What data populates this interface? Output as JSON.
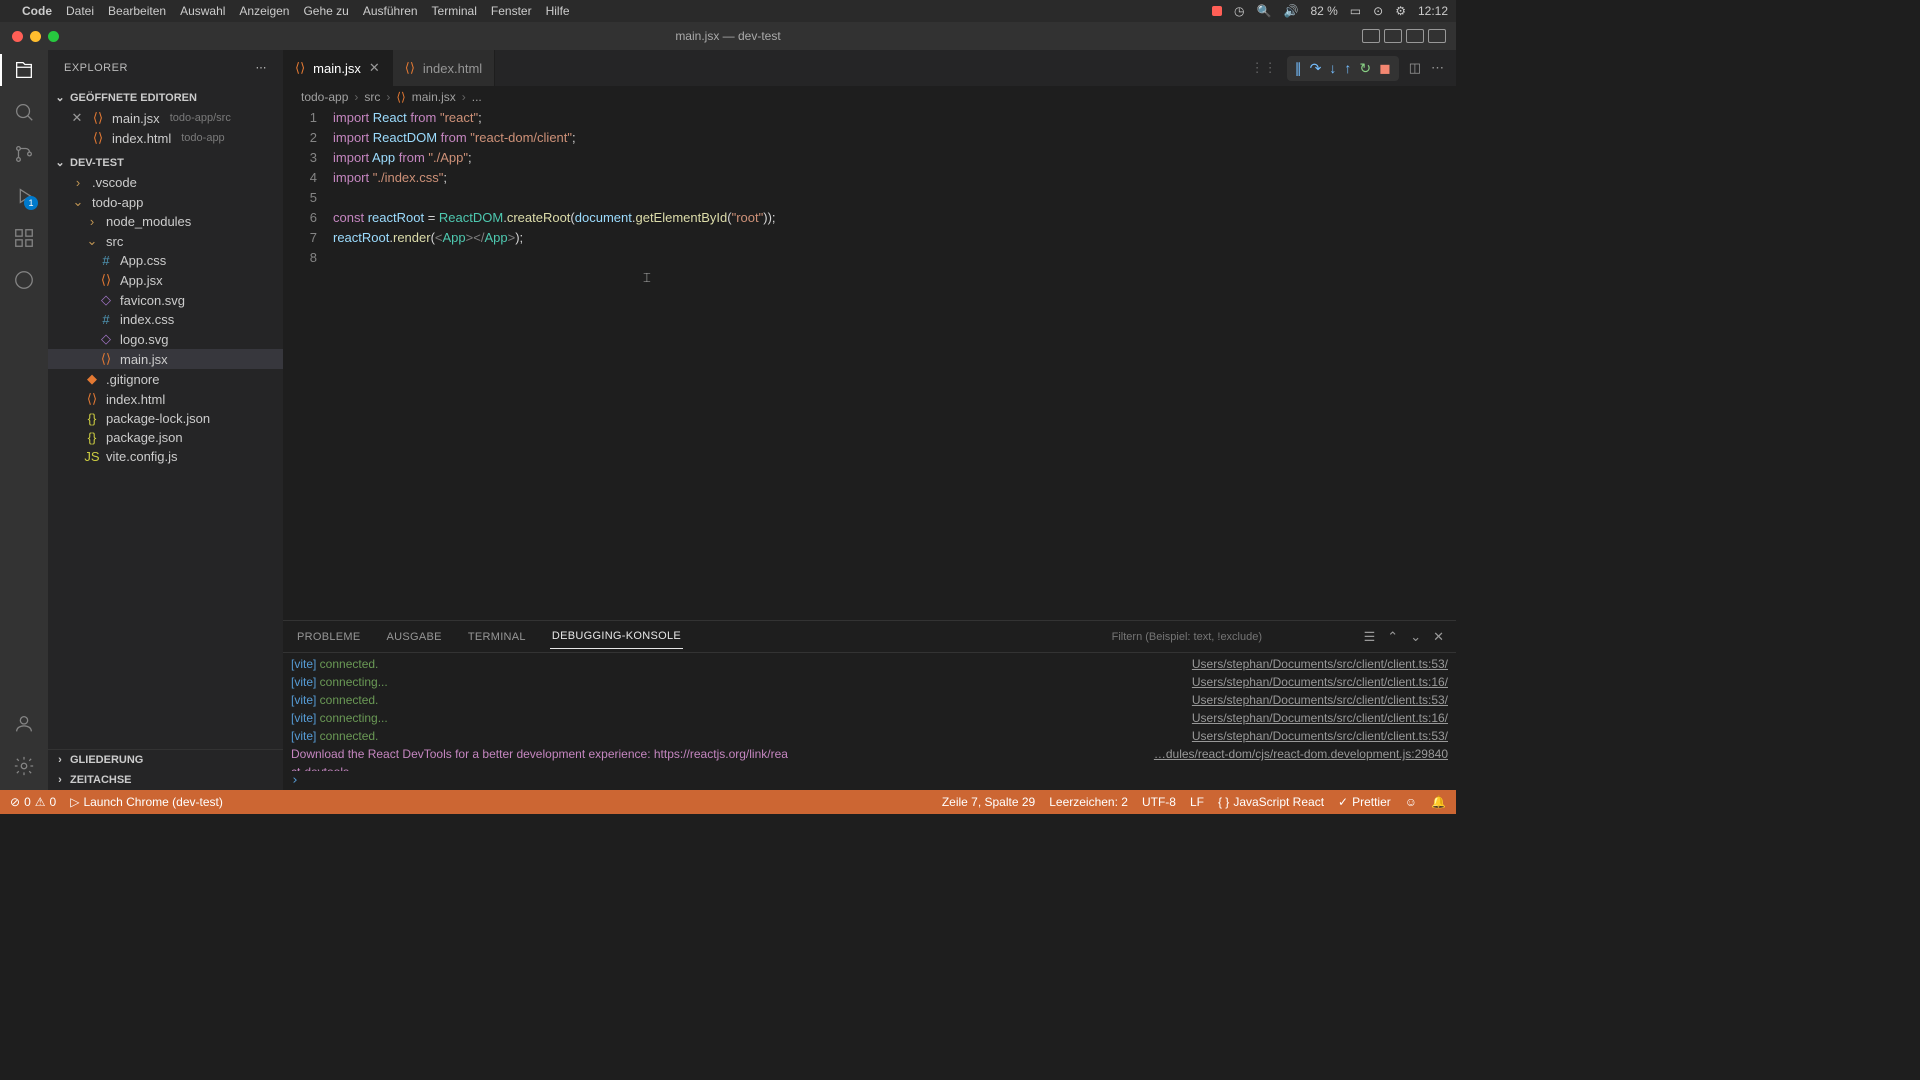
{
  "menubar": {
    "app": "Code",
    "items": [
      "Datei",
      "Bearbeiten",
      "Auswahl",
      "Anzeigen",
      "Gehe zu",
      "Ausführen",
      "Terminal",
      "Fenster",
      "Hilfe"
    ],
    "battery": "82 %",
    "time": "12:12"
  },
  "window": {
    "title": "main.jsx — dev-test"
  },
  "sidebar": {
    "title": "EXPLORER",
    "openEditors": {
      "label": "GEÖFFNETE EDITOREN",
      "items": [
        {
          "name": "main.jsx",
          "hint": "todo-app/src",
          "icon": "jsx",
          "close": true
        },
        {
          "name": "index.html",
          "hint": "todo-app",
          "icon": "html",
          "close": false
        }
      ]
    },
    "project": {
      "label": "DEV-TEST",
      "tree": [
        {
          "name": ".vscode",
          "type": "folder",
          "level": 1
        },
        {
          "name": "todo-app",
          "type": "folder",
          "level": 1,
          "open": true
        },
        {
          "name": "node_modules",
          "type": "folder",
          "level": 2
        },
        {
          "name": "src",
          "type": "folder",
          "level": 2,
          "open": true
        },
        {
          "name": "App.css",
          "type": "css",
          "level": 3
        },
        {
          "name": "App.jsx",
          "type": "jsx",
          "level": 3
        },
        {
          "name": "favicon.svg",
          "type": "svg",
          "level": 3
        },
        {
          "name": "index.css",
          "type": "css",
          "level": 3
        },
        {
          "name": "logo.svg",
          "type": "svg",
          "level": 3
        },
        {
          "name": "main.jsx",
          "type": "jsx",
          "level": 3,
          "selected": true
        },
        {
          "name": ".gitignore",
          "type": "git",
          "level": 2
        },
        {
          "name": "index.html",
          "type": "html",
          "level": 2
        },
        {
          "name": "package-lock.json",
          "type": "json",
          "level": 2
        },
        {
          "name": "package.json",
          "type": "json",
          "level": 2
        },
        {
          "name": "vite.config.js",
          "type": "js",
          "level": 2
        }
      ]
    },
    "outline": "GLIEDERUNG",
    "timeline": "ZEITACHSE"
  },
  "activitybar": {
    "debugBadge": "1"
  },
  "tabs": [
    {
      "name": "main.jsx",
      "icon": "jsx",
      "active": true,
      "close": true
    },
    {
      "name": "index.html",
      "icon": "html",
      "active": false,
      "close": false
    }
  ],
  "breadcrumbs": [
    "todo-app",
    "src",
    "main.jsx",
    "..."
  ],
  "code": {
    "lines": 8
  },
  "panel": {
    "tabs": [
      "PROBLEME",
      "AUSGABE",
      "TERMINAL",
      "DEBUGGING-KONSOLE"
    ],
    "active": "DEBUGGING-KONSOLE",
    "filterPlaceholder": "Filtern (Beispiel: text, !exclude)",
    "console": [
      {
        "l": "[vite] connected.",
        "r": "Users/stephan/Documents/src/client/client.ts:53/"
      },
      {
        "l": "[vite] connecting...",
        "r": "Users/stephan/Documents/src/client/client.ts:16/"
      },
      {
        "l": "[vite] connected.",
        "r": "Users/stephan/Documents/src/client/client.ts:53/"
      },
      {
        "l": "[vite] connecting...",
        "r": "Users/stephan/Documents/src/client/client.ts:16/"
      },
      {
        "l": "[vite] connected.",
        "r": "Users/stephan/Documents/src/client/client.ts:53/"
      },
      {
        "l": "Download the React DevTools for a better development experience: https://reactjs.org/link/rea",
        "r": "…dules/react-dom/cjs/react-dom.development.js:29840"
      },
      {
        "l": "ct-devtools",
        "r": ""
      }
    ]
  },
  "statusbar": {
    "errors": "0",
    "warnings": "0",
    "launch": "Launch Chrome (dev-test)",
    "pos": "Zeile 7, Spalte 29",
    "spaces": "Leerzeichen: 2",
    "enc": "UTF-8",
    "eol": "LF",
    "lang": "JavaScript React",
    "prettier": "Prettier"
  }
}
